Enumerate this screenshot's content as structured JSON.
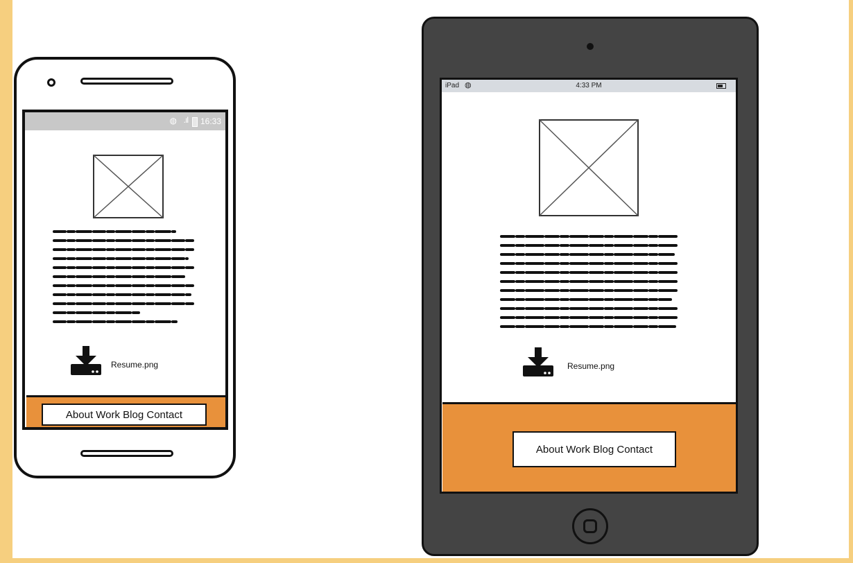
{
  "colors": {
    "background": "#f6cf7f",
    "paper": "#ffffff",
    "nav_bar": "#e8913b",
    "tablet_body": "#444444",
    "phone_status_bar": "#c8c8c8",
    "tablet_status_bar": "#d7dbe0"
  },
  "phone": {
    "status_time": "16:33",
    "wifi_icon": "wifi-icon",
    "signal_icon": "signal-icon",
    "file_label": "Resume.png",
    "nav_label": "About Work Blog Contact"
  },
  "tablet": {
    "status_device": "iPad",
    "status_time": "4:33 PM",
    "file_label": "Resume.png",
    "nav_label": "About Work Blog Contact"
  },
  "icons": [
    "image-placeholder-icon",
    "download-icon",
    "wifi-icon",
    "battery-icon",
    "home-button-icon"
  ]
}
